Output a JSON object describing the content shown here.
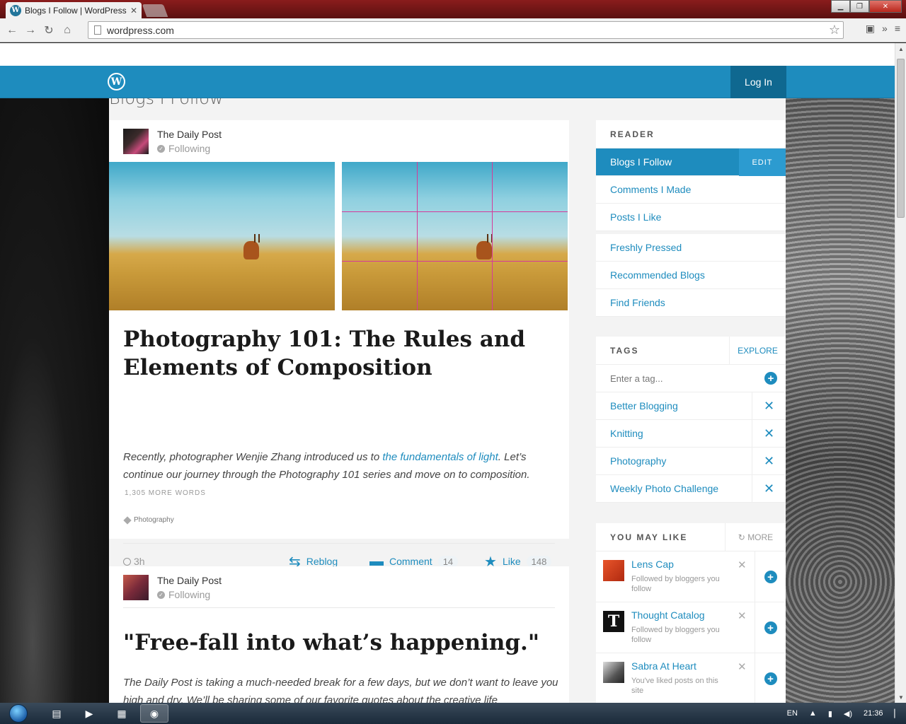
{
  "browser": {
    "tab_title": "Blogs I Follow | WordPress",
    "url": "wordpress.com"
  },
  "masthead": {
    "login_label": "Log In"
  },
  "page": {
    "heading": "Blogs I Follow"
  },
  "posts": [
    {
      "blog_name": "The Daily Post",
      "follow_status": "Following",
      "title": "Photography 101: The Rules and Elements of Composition",
      "excerpt_before": "Recently, photographer Wenjie Zhang introduced us to ",
      "excerpt_link": "the fundamentals of light",
      "excerpt_after": ". Let’s continue our journey through the Photography 101 series and move on to composition.",
      "more_words": "1,305 MORE WORDS",
      "tag": "Photography",
      "time": "3h",
      "reblog_label": "Reblog",
      "comment_label": "Comment",
      "comment_count": "14",
      "like_label": "Like",
      "like_count": "148"
    },
    {
      "blog_name": "The Daily Post",
      "follow_status": "Following",
      "title": "\"Free-fall into what’s happening.\"",
      "excerpt": "The Daily Post is taking a much-needed break for a few days, but we don’t want to leave you high and dry. We’ll be sharing some of our favorite quotes about the creative life"
    }
  ],
  "reader": {
    "header": "READER",
    "items": [
      {
        "label": "Blogs I Follow",
        "active": true
      },
      {
        "label": "Comments I Made"
      },
      {
        "label": "Posts I Like"
      },
      {
        "label": "Freshly Pressed"
      },
      {
        "label": "Recommended Blogs"
      },
      {
        "label": "Find Friends"
      }
    ],
    "edit_label": "EDIT"
  },
  "tags": {
    "header": "TAGS",
    "explore_label": "EXPLORE",
    "input_placeholder": "Enter a tag...",
    "items": [
      "Better Blogging",
      "Knitting",
      "Photography",
      "Weekly Photo Challenge"
    ]
  },
  "you_may_like": {
    "header": "YOU MAY LIKE",
    "more_label": "MORE",
    "items": [
      {
        "name": "Lens Cap",
        "reason": "Followed by bloggers you follow"
      },
      {
        "name": "Thought Catalog",
        "reason": "Followed by bloggers you follow"
      },
      {
        "name": "Sabra At Heart",
        "reason": "You've liked posts on this site"
      }
    ]
  },
  "taskbar": {
    "language": "EN",
    "clock": "21:36"
  },
  "colors": {
    "accent": "#1e8cbe",
    "active_item": "#1e8cbe",
    "login_bg": "#0f6890"
  }
}
